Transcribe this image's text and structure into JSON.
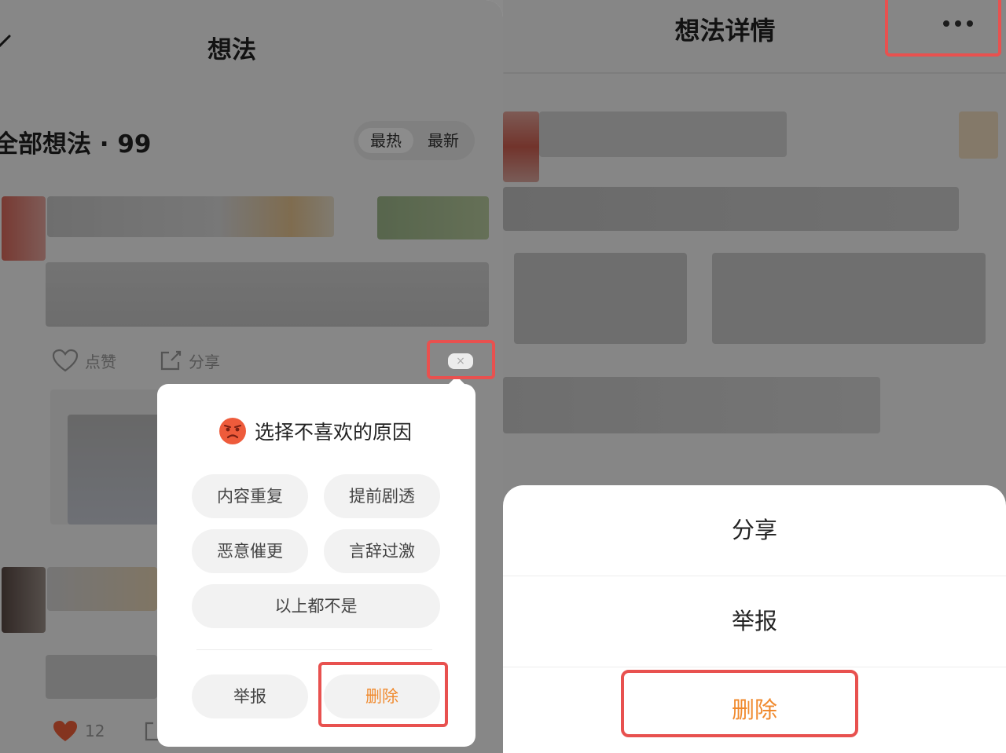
{
  "left": {
    "title": "想法",
    "section_title": "全部想法 · 99",
    "sort_hot": "最热",
    "sort_new": "最新",
    "like_label": "点赞",
    "share_label": "分享",
    "close_glyph": "×",
    "like_count": "12",
    "dislike_popup": {
      "heading": "选择不喜欢的原因",
      "reasons": [
        "内容重复",
        "提前剧透",
        "恶意催更",
        "言辞过激"
      ],
      "none_label": "以上都不是",
      "report_label": "举报",
      "delete_label": "删除"
    }
  },
  "right": {
    "title": "想法详情",
    "sheet": {
      "share_label": "分享",
      "report_label": "举报",
      "delete_label": "删除"
    }
  },
  "colors": {
    "accent_orange": "#f08a2e",
    "highlight_red": "#e8514f",
    "like_red": "#f0603a"
  },
  "icons": [
    "back-arrow-icon",
    "heart-icon",
    "share-icon",
    "close-icon",
    "angry-face-icon",
    "more-dots-icon"
  ]
}
